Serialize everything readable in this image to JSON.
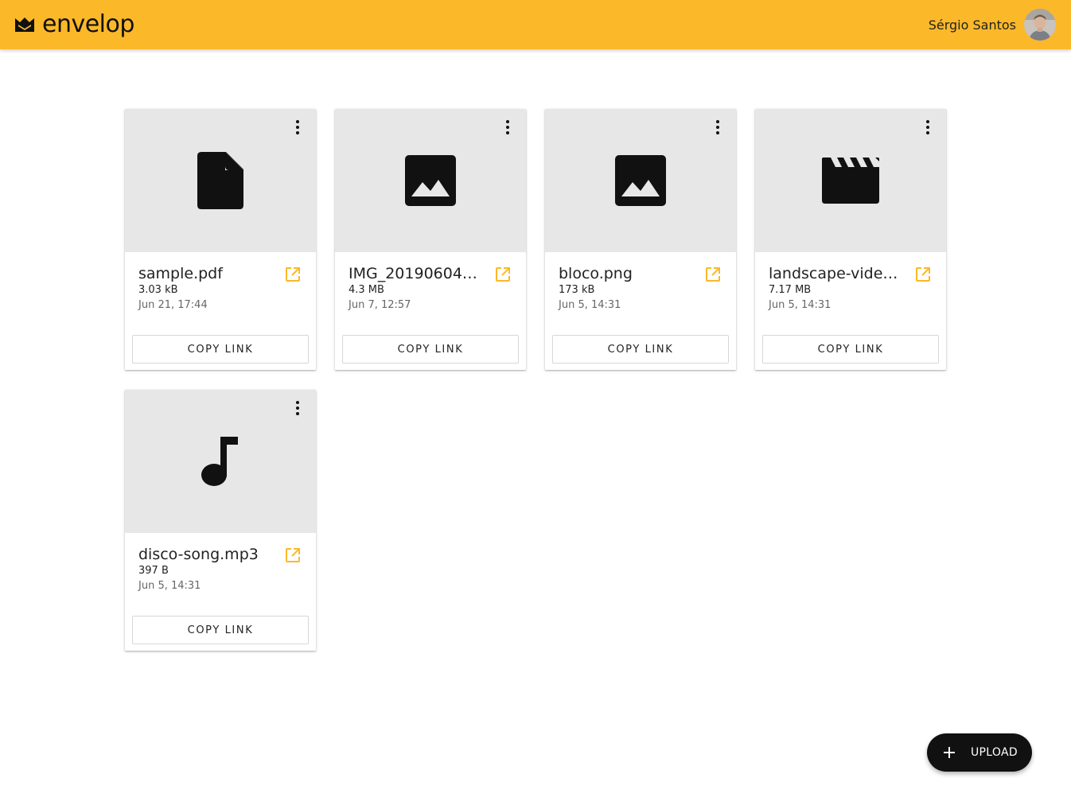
{
  "app": {
    "name": "envelop",
    "brand_color": "#fbb829"
  },
  "user": {
    "name": "Sérgio Santos"
  },
  "files": [
    {
      "name": "sample.pdf",
      "size": "3.03 kB",
      "date": "Jun 21, 17:44",
      "icon": "document-icon"
    },
    {
      "name": "IMG_20190604…",
      "size": "4.3 MB",
      "date": "Jun 7, 12:57",
      "icon": "image-icon"
    },
    {
      "name": "bloco.png",
      "size": "173 kB",
      "date": "Jun 5, 14:31",
      "icon": "image-icon"
    },
    {
      "name": "landscape-vide…",
      "size": "7.17 MB",
      "date": "Jun 5, 14:31",
      "icon": "movie-icon"
    },
    {
      "name": "disco-song.mp3",
      "size": "397 B",
      "date": "Jun 5, 14:31",
      "icon": "music-note-icon"
    }
  ],
  "card": {
    "copy_label": "COPY LINK"
  },
  "fab": {
    "label": "UPLOAD"
  }
}
